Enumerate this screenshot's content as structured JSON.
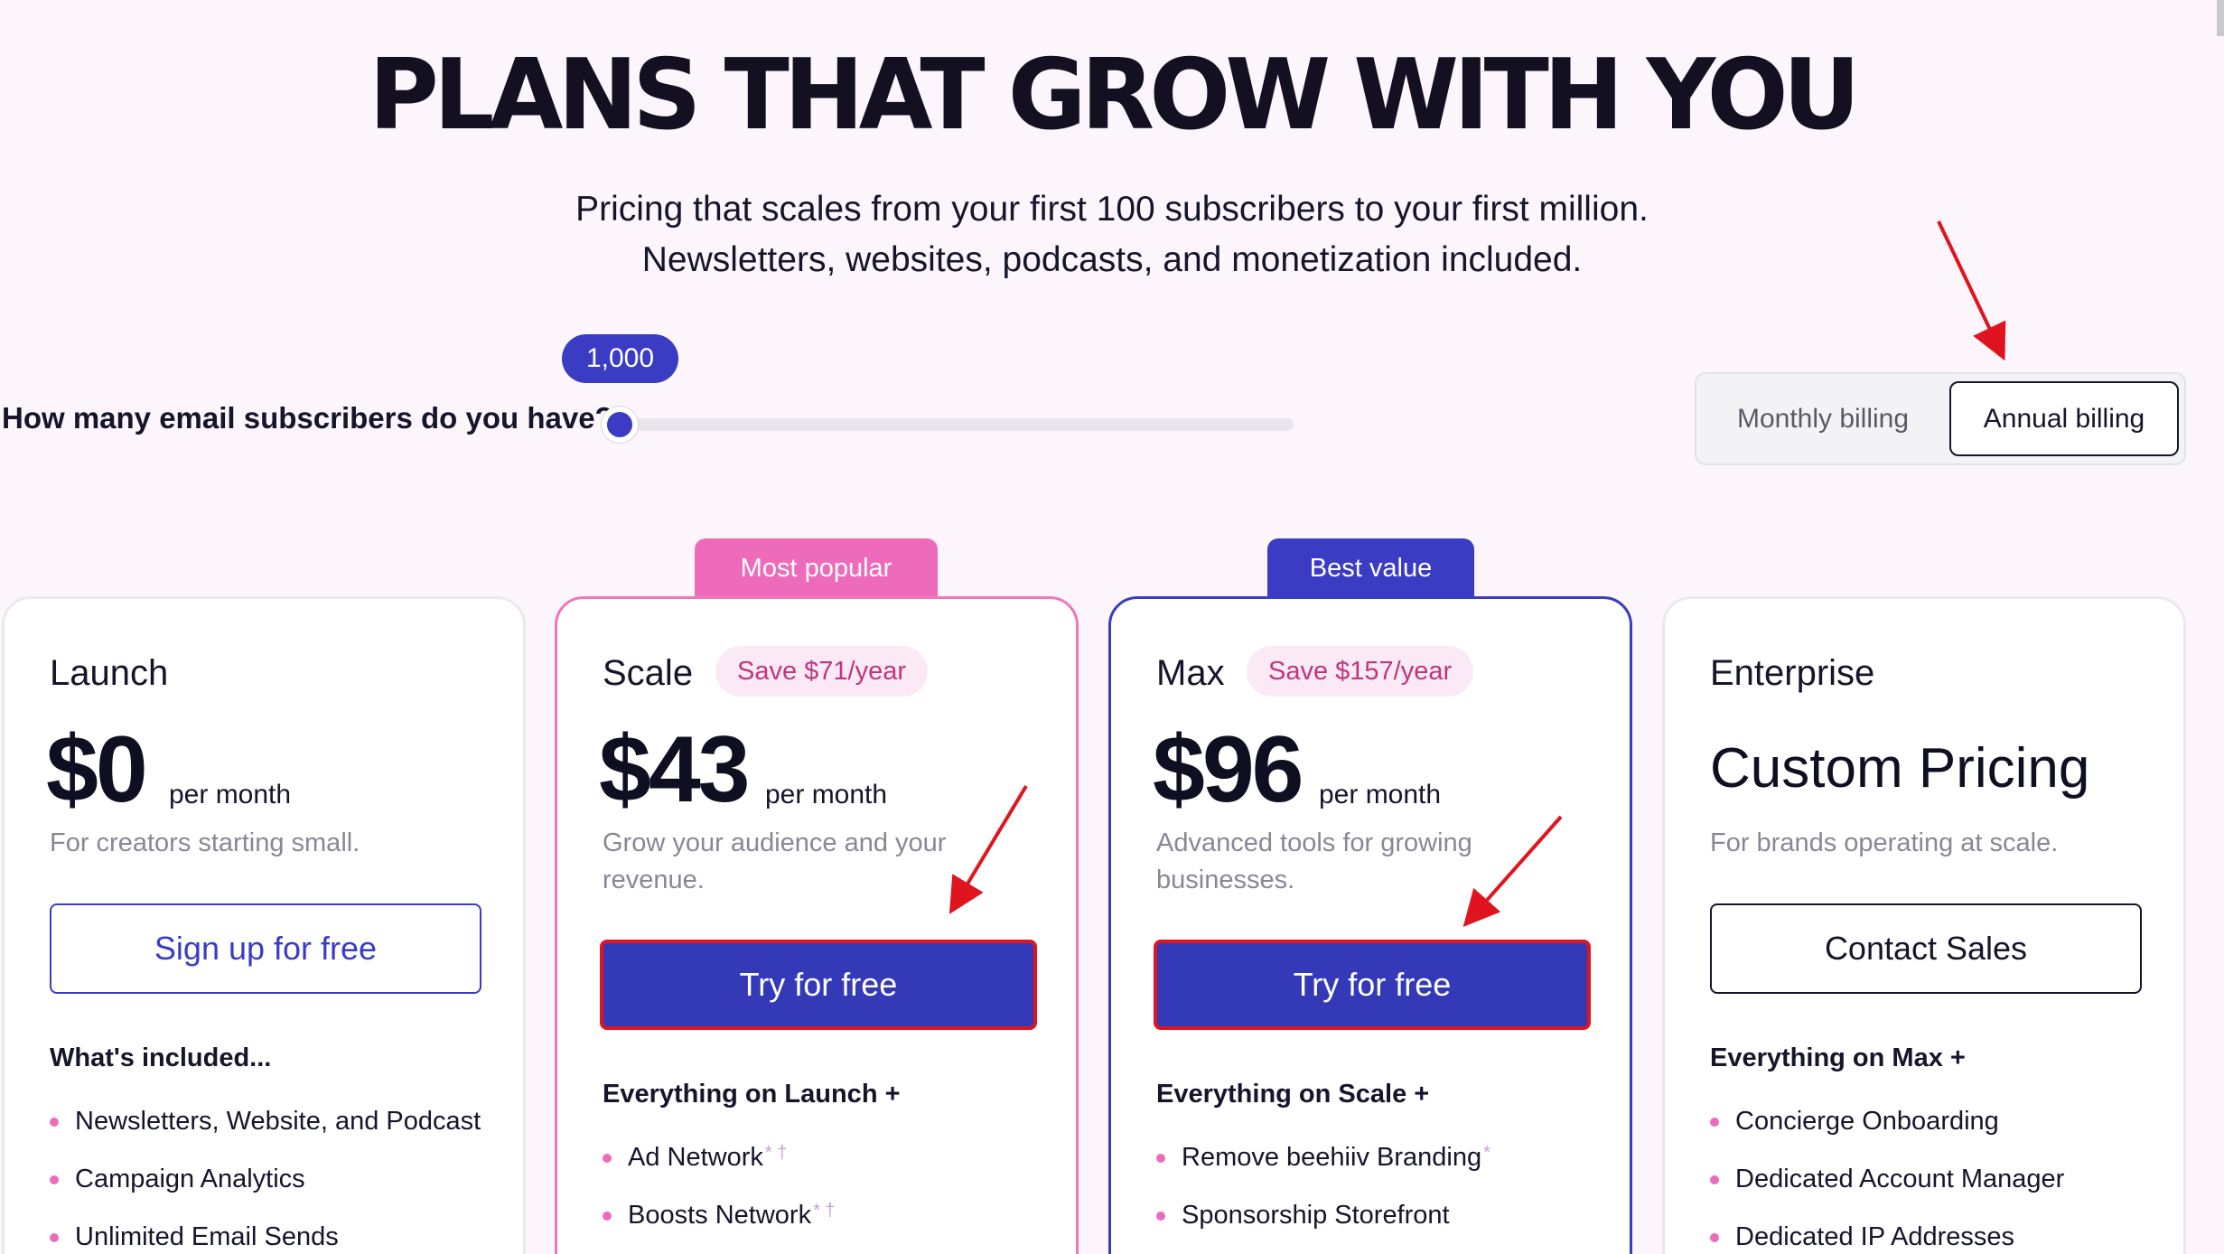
{
  "hero": {
    "title": "PLANS THAT GROW WITH YOU",
    "subtitle_line1": "Pricing that scales from your first 100 subscribers to your first million.",
    "subtitle_line2": "Newsletters, websites, podcasts, and monetization included."
  },
  "slider": {
    "label": "How many email subscribers do you have?",
    "value": "1,000",
    "fraction": 0.0
  },
  "billing": {
    "monthly": "Monthly billing",
    "annual": "Annual billing",
    "selected": "annual"
  },
  "plans": {
    "launch": {
      "name": "Launch",
      "price": "$0",
      "unit": "per month",
      "desc": "For creators starting small.",
      "cta": "Sign up for free",
      "features_title": "What's included...",
      "features": [
        "Newsletters, Website, and Podcast",
        "Campaign Analytics",
        "Unlimited Email Sends"
      ]
    },
    "scale": {
      "tag": "Most popular",
      "name": "Scale",
      "save": "Save $71/year",
      "price": "$43",
      "unit": "per month",
      "desc": "Grow your audience and your revenue.",
      "cta": "Try for free",
      "features_title": "Everything on Launch +",
      "features": [
        "Ad Network",
        "Boosts Network"
      ],
      "marks": [
        "* †",
        "* †"
      ]
    },
    "max": {
      "tag": "Best value",
      "name": "Max",
      "save": "Save $157/year",
      "price": "$96",
      "unit": "per month",
      "desc": "Advanced tools for growing businesses.",
      "cta": "Try for free",
      "features_title": "Everything on Scale +",
      "features": [
        "Remove beehiiv Branding",
        "Sponsorship Storefront"
      ],
      "marks": [
        "*",
        ""
      ]
    },
    "enterprise": {
      "name": "Enterprise",
      "price": "Custom Pricing",
      "desc": "For brands operating at scale.",
      "cta": "Contact Sales",
      "features_title": "Everything on Max +",
      "features": [
        "Concierge Onboarding",
        "Dedicated Account Manager",
        "Dedicated IP Addresses"
      ]
    }
  },
  "colors": {
    "accent_blue": "#3a3cc4",
    "accent_pink": "#ee6bbb",
    "annotation_red": "#e0141f"
  }
}
